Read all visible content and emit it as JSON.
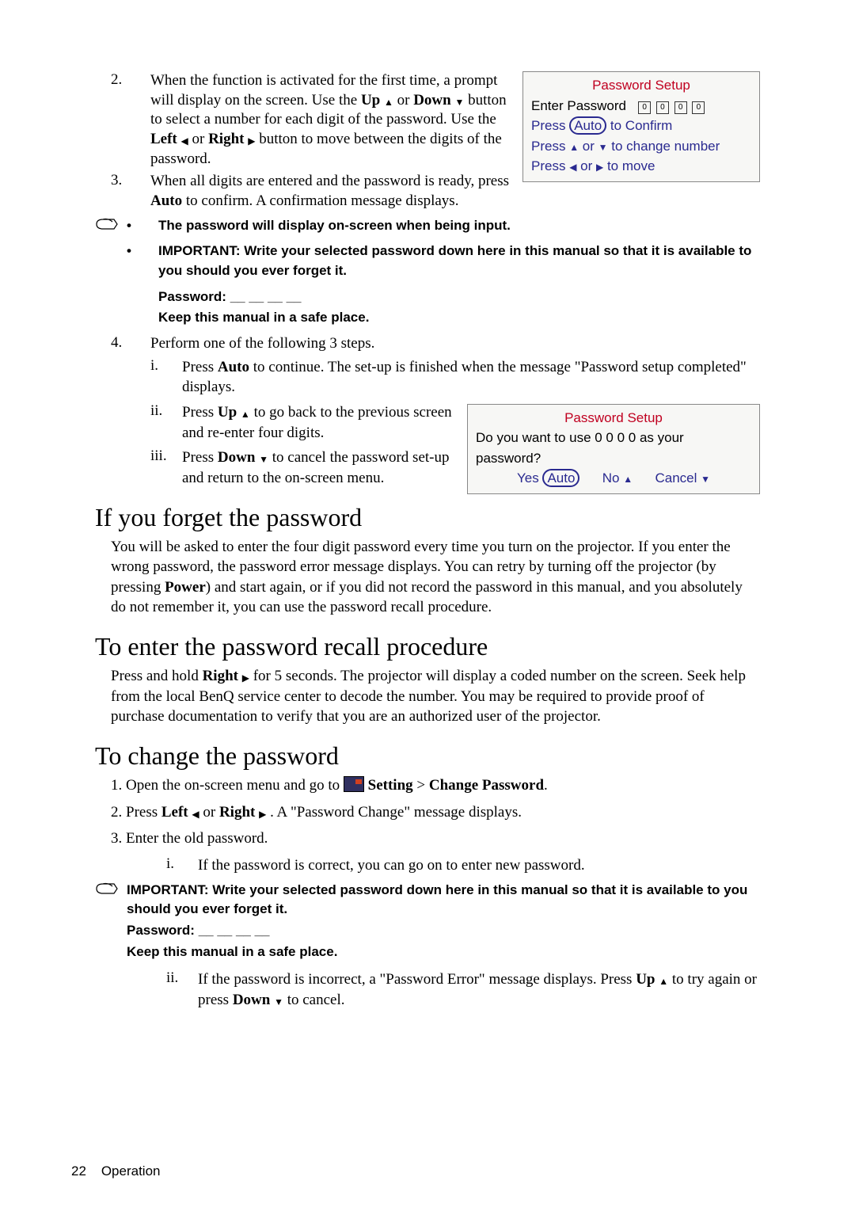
{
  "step2": {
    "num": "2.",
    "t1": "When the function is activated for the first time, a prompt will display on the screen. Use the ",
    "up": "Up",
    "t2": " or ",
    "down": "Down",
    "t3": " button to select a number for each digit of the password. Use the ",
    "left": "Left",
    "t4": " or ",
    "right": "Right",
    "t5": " button to move between the digits of the password."
  },
  "step3": {
    "num": "3.",
    "t1": "When all digits are entered and the password is ready, press ",
    "auto": "Auto",
    "t2": " to confirm. A confirmation message displays."
  },
  "osd1": {
    "title": "Password Setup",
    "enter": "Enter Password",
    "confirm_pre": "Press ",
    "confirm_auto": "Auto",
    "confirm_post": " to Confirm",
    "change_a": "Press ",
    "change_b": " or ",
    "change_c": " to change number",
    "move_a": "Press ",
    "move_b": " or ",
    "move_c": " to move",
    "d": "0"
  },
  "notes": {
    "n1": "The password will display on-screen when being input.",
    "n2": "IMPORTANT: Write your selected password down here in this manual so that it is available to you should you ever forget it.",
    "pw": "Password: __ __ __ __",
    "keep": "Keep this manual in a safe place."
  },
  "step4": {
    "num": "4.",
    "lead": "Perform one of the following 3 steps.",
    "i_num": "i.",
    "i_a": "Press ",
    "i_auto": "Auto",
    "i_b": " to continue. The set-up is finished when the message \"Password setup completed\" displays.",
    "ii_num": "ii.",
    "ii_a": "Press ",
    "ii_up": "Up",
    "ii_b": " to go back to the previous screen and re-enter four digits.",
    "iii_num": "iii.",
    "iii_a": "Press ",
    "iii_down": "Down",
    "iii_b": " to cancel the password set-up and return to the on-screen menu."
  },
  "osd2": {
    "title": "Password Setup",
    "q": "Do you want to use 0 0 0 0 as your password?",
    "yes": "Yes ",
    "auto": "Auto",
    "no": "No ",
    "cancel": "Cancel "
  },
  "forget": {
    "h": "If you forget the password",
    "p_a": "You will be asked to enter the four digit password every time you turn on the projector. If you enter the wrong password, the password error message displays. You can retry by turning off the projector (by pressing ",
    "power": "Power",
    "p_b": ") and start again, or if you did not record the password in this manual, and you absolutely do not remember it, you can use the password recall procedure."
  },
  "recall": {
    "h": "To enter the password recall procedure",
    "p_a": "Press and hold ",
    "right": "Right",
    "p_b": " for 5 seconds. The projector will display a coded number on the screen. Seek help from the local BenQ service center to decode the number. You may be required to provide proof of purchase documentation to verify that you are an authorized user of the projector."
  },
  "change": {
    "h": "To change the password",
    "s1_a": "1. Open the on-screen menu and go to ",
    "s1_b": " Setting",
    "s1_c": " > ",
    "s1_d": "Change Password",
    "s1_e": ".",
    "s2_a": "2. Press ",
    "s2_left": "Left",
    "s2_b": " or ",
    "s2_right": "Right",
    "s2_c": " . A \"Password Change\" message displays.",
    "s3": "3. Enter the old password.",
    "i_num": "i.",
    "i": "If the password is correct, you can go on to enter new password.",
    "imp": "IMPORTANT: Write your selected password down here in this manual so that it is available to you should you ever forget it.",
    "pw": "Password: __ __ __ __",
    "keep": "Keep this manual in a safe place.",
    "ii_num": "ii.",
    "ii_a": "If the password is incorrect, a \"Password Error\" message displays. Press ",
    "ii_up": "Up",
    "ii_b": " to try again or press ",
    "ii_down": "Down",
    "ii_c": " to cancel."
  },
  "footer": {
    "page": "22",
    "section": "Operation"
  }
}
